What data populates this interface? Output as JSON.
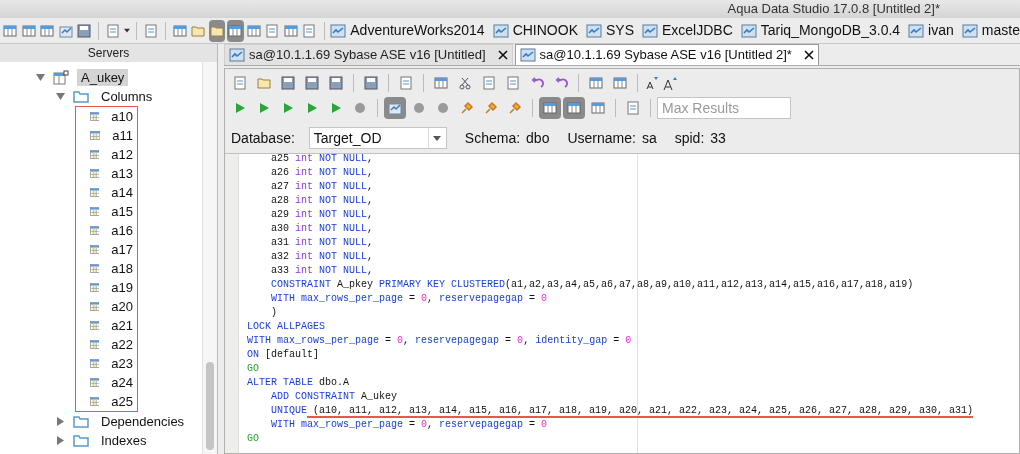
{
  "window": {
    "title": "Aqua Data Studio 17.0.8 [Untitled 2]*"
  },
  "bookmarks": [
    "AdventureWorks2014",
    "CHINOOK",
    "SYS",
    "ExcelJDBC",
    "Tariq_MongoDB_3.0.4",
    "ivan",
    "maste"
  ],
  "sidebar": {
    "title": "Servers",
    "tree": [
      {
        "label": "A_ukey",
        "kind": "key",
        "expanded": true,
        "selected": true,
        "children": [
          {
            "label": "Columns",
            "kind": "folder",
            "expanded": true,
            "selected": false,
            "children": [
              {
                "label": "a10",
                "kind": "column"
              },
              {
                "label": "a11",
                "kind": "column"
              },
              {
                "label": "a12",
                "kind": "column"
              },
              {
                "label": "a13",
                "kind": "column"
              },
              {
                "label": "a14",
                "kind": "column"
              },
              {
                "label": "a15",
                "kind": "column"
              },
              {
                "label": "a16",
                "kind": "column"
              },
              {
                "label": "a17",
                "kind": "column"
              },
              {
                "label": "a18",
                "kind": "column"
              },
              {
                "label": "a19",
                "kind": "column"
              },
              {
                "label": "a20",
                "kind": "column"
              },
              {
                "label": "a21",
                "kind": "column"
              },
              {
                "label": "a22",
                "kind": "column"
              },
              {
                "label": "a23",
                "kind": "column"
              },
              {
                "label": "a24",
                "kind": "column"
              },
              {
                "label": "a25",
                "kind": "column"
              }
            ]
          },
          {
            "label": "Dependencies",
            "kind": "folder",
            "expanded": false,
            "selected": false
          },
          {
            "label": "Indexes",
            "kind": "folder",
            "expanded": false,
            "selected": false
          }
        ]
      }
    ]
  },
  "tabs": [
    {
      "label": "sa@10.1.1.69 Sybase ASE v16 [Untitled]",
      "selected": false
    },
    {
      "label": "sa@10.1.1.69 Sybase ASE v16 [Untitled 2]*",
      "selected": true
    }
  ],
  "max_results": {
    "placeholder": "Max Results"
  },
  "connection": {
    "database_label": "Database:",
    "database": "Target_OD",
    "schema_label": "Schema:",
    "schema": "dbo",
    "username_label": "Username:",
    "username": "sa",
    "spid_label": "spid:",
    "spid": "33"
  },
  "editor": {
    "lines": [
      [
        {
          "text": "    a25 ",
          "kind": "plain"
        },
        {
          "text": "int",
          "kind": "type"
        },
        {
          "text": " NOT NULL",
          "kind": "keyword"
        },
        {
          "text": ",",
          "kind": "plain"
        }
      ],
      [
        {
          "text": "    a26 ",
          "kind": "plain"
        },
        {
          "text": "int",
          "kind": "type"
        },
        {
          "text": " NOT NULL",
          "kind": "keyword"
        },
        {
          "text": ",",
          "kind": "plain"
        }
      ],
      [
        {
          "text": "    a27 ",
          "kind": "plain"
        },
        {
          "text": "int",
          "kind": "type"
        },
        {
          "text": " NOT NULL",
          "kind": "keyword"
        },
        {
          "text": ",",
          "kind": "plain"
        }
      ],
      [
        {
          "text": "    a28 ",
          "kind": "plain"
        },
        {
          "text": "int",
          "kind": "type"
        },
        {
          "text": " NOT NULL",
          "kind": "keyword"
        },
        {
          "text": ",",
          "kind": "plain"
        }
      ],
      [
        {
          "text": "    a29 ",
          "kind": "plain"
        },
        {
          "text": "int",
          "kind": "type"
        },
        {
          "text": " NOT NULL",
          "kind": "keyword"
        },
        {
          "text": ",",
          "kind": "plain"
        }
      ],
      [
        {
          "text": "    a30 ",
          "kind": "plain"
        },
        {
          "text": "int",
          "kind": "type"
        },
        {
          "text": " NOT NULL",
          "kind": "keyword"
        },
        {
          "text": ",",
          "kind": "plain"
        }
      ],
      [
        {
          "text": "    a31 ",
          "kind": "plain"
        },
        {
          "text": "int",
          "kind": "type"
        },
        {
          "text": " NOT NULL",
          "kind": "keyword"
        },
        {
          "text": ",",
          "kind": "plain"
        }
      ],
      [
        {
          "text": "    a32 ",
          "kind": "plain"
        },
        {
          "text": "int",
          "kind": "type"
        },
        {
          "text": " NOT NULL",
          "kind": "keyword"
        },
        {
          "text": ",",
          "kind": "plain"
        }
      ],
      [
        {
          "text": "    a33 ",
          "kind": "plain"
        },
        {
          "text": "int",
          "kind": "type"
        },
        {
          "text": " NOT NULL",
          "kind": "keyword"
        },
        {
          "text": ",",
          "kind": "plain"
        }
      ],
      [
        {
          "text": "    CONSTRAINT",
          "kind": "keyword"
        },
        {
          "text": " A_pkey ",
          "kind": "plain"
        },
        {
          "text": "PRIMARY KEY CLUSTERED",
          "kind": "keyword"
        },
        {
          "text": "(a1,a2,a3,a4,a5,a6,a7,a8,a9,a10,a11,a12,a13,a14,a15,a16,a17,a18,a19)",
          "kind": "plain"
        }
      ],
      [
        {
          "text": "    WITH max_rows_per_page",
          "kind": "keyword"
        },
        {
          "text": " = ",
          "kind": "plain"
        },
        {
          "text": "0",
          "kind": "number"
        },
        {
          "text": ", ",
          "kind": "plain"
        },
        {
          "text": "reservepagegap",
          "kind": "keyword"
        },
        {
          "text": " = ",
          "kind": "plain"
        },
        {
          "text": "0",
          "kind": "number"
        }
      ],
      [
        {
          "text": "    )",
          "kind": "plain"
        }
      ],
      [
        {
          "text": "LOCK ALLPAGES",
          "kind": "keyword"
        }
      ],
      [
        {
          "text": "WITH max_rows_per_page",
          "kind": "keyword"
        },
        {
          "text": " = ",
          "kind": "plain"
        },
        {
          "text": "0",
          "kind": "number"
        },
        {
          "text": ", ",
          "kind": "plain"
        },
        {
          "text": "reservepagegap",
          "kind": "keyword"
        },
        {
          "text": " = ",
          "kind": "plain"
        },
        {
          "text": "0",
          "kind": "number"
        },
        {
          "text": ", ",
          "kind": "plain"
        },
        {
          "text": "identity_gap",
          "kind": "keyword"
        },
        {
          "text": " = ",
          "kind": "plain"
        },
        {
          "text": "0",
          "kind": "number"
        }
      ],
      [
        {
          "text": "ON",
          "kind": "keyword"
        },
        {
          "text": " [default]",
          "kind": "plain"
        }
      ],
      [
        {
          "text": "GO",
          "kind": "go"
        }
      ],
      [
        {
          "text": "ALTER TABLE",
          "kind": "keyword"
        },
        {
          "text": " dbo.A",
          "kind": "plain"
        }
      ],
      [
        {
          "text": "    ADD CONSTRAINT",
          "kind": "keyword"
        },
        {
          "text": " A_ukey",
          "kind": "plain"
        }
      ],
      [
        {
          "text": "    UNIQUE",
          "kind": "keyword"
        },
        {
          "text": " (a10, a11, a12, a13, a14, a15, a16, a17, a18, a19, a20, a21, a22, a23, a24, a25, a26, a27, a28, a29, a30, a31)",
          "kind": "plain",
          "underlined": true
        }
      ],
      [
        {
          "text": "    WITH max_rows_per_page",
          "kind": "keyword"
        },
        {
          "text": " = ",
          "kind": "plain"
        },
        {
          "text": "0",
          "kind": "number"
        },
        {
          "text": ", ",
          "kind": "plain"
        },
        {
          "text": "reservepagegap",
          "kind": "keyword"
        },
        {
          "text": " = ",
          "kind": "plain"
        },
        {
          "text": "0",
          "kind": "number"
        }
      ],
      [
        {
          "text": "GO",
          "kind": "go"
        }
      ]
    ]
  }
}
